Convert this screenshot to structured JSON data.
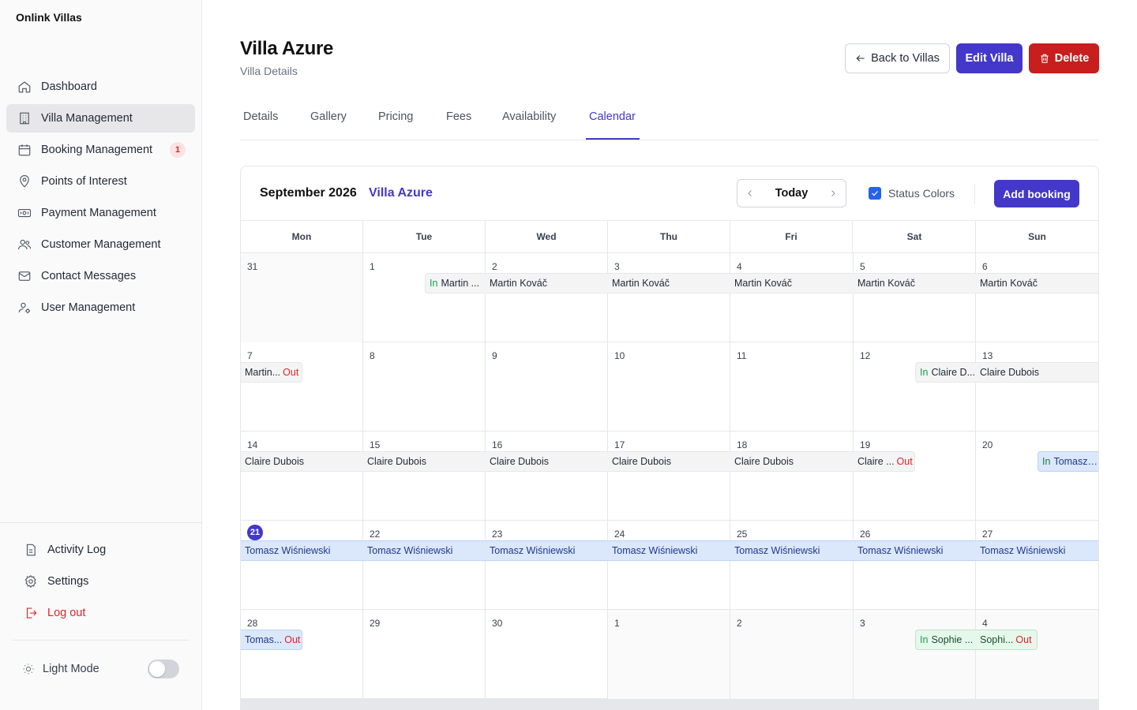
{
  "sidebar": {
    "brand": "Onlink Villas",
    "items": [
      {
        "label": "Dashboard",
        "icon": "home-icon"
      },
      {
        "label": "Villa Management",
        "icon": "building-icon",
        "active": true
      },
      {
        "label": "Booking Management",
        "icon": "calendar-icon",
        "badge": "1"
      },
      {
        "label": "Points of Interest",
        "icon": "map-pin-icon"
      },
      {
        "label": "Payment Management",
        "icon": "banknote-icon"
      },
      {
        "label": "Customer Management",
        "icon": "users-icon"
      },
      {
        "label": "Contact Messages",
        "icon": "mail-icon"
      },
      {
        "label": "User Management",
        "icon": "user-cog-icon"
      }
    ],
    "bottom": {
      "activity": "Activity Log",
      "settings": "Settings",
      "logout": "Log out",
      "mode": "Light Mode"
    }
  },
  "header": {
    "title": "Villa Azure",
    "subtitle": "Villa Details",
    "back_label": "Back to Villas",
    "edit_label": "Edit Villa",
    "delete_label": "Delete"
  },
  "tabs": [
    "Details",
    "Gallery",
    "Pricing",
    "Fees",
    "Availability",
    "Calendar"
  ],
  "calendar": {
    "month": "September 2026",
    "villa": "Villa Azure",
    "today_label": "Today",
    "status_colors_label": "Status Colors",
    "status_colors_checked": true,
    "add_booking_label": "Add booking",
    "weekdays": [
      "Mon",
      "Tue",
      "Wed",
      "Thu",
      "Fri",
      "Sat",
      "Sun"
    ],
    "weeks": [
      [
        "31",
        "1",
        "2",
        "3",
        "4",
        "5",
        "6"
      ],
      [
        "7",
        "8",
        "9",
        "10",
        "11",
        "12",
        "13"
      ],
      [
        "14",
        "15",
        "16",
        "17",
        "18",
        "19",
        "20"
      ],
      [
        "21",
        "22",
        "23",
        "24",
        "25",
        "26",
        "27"
      ],
      [
        "28",
        "29",
        "30",
        "1",
        "2",
        "3",
        "4"
      ]
    ],
    "today_day": "21",
    "in_label": "In",
    "out_label": "Out",
    "events": {
      "w1_tue": "Martin ...",
      "w1_name": "Martin Kováč",
      "w2_mon": "Martin...",
      "w2_sat": "Claire D...",
      "w2_sun": "Claire Dubois",
      "w3_name": "Claire Dubois",
      "w3_sat": "Claire ...",
      "w3_sun": "Tomasz ...",
      "w4_name": "Tomasz Wiśniewski",
      "w5_mon": "Tomas...",
      "w5_sat": "Sophie ...",
      "w5_sun": "Sophi..."
    }
  },
  "colors": {
    "accent": "#4338ca",
    "danger": "#c81e1e",
    "booking_blue": "#dbe7fb",
    "booking_green": "#e6f7ec",
    "booking_gray": "#f4f4f5"
  }
}
